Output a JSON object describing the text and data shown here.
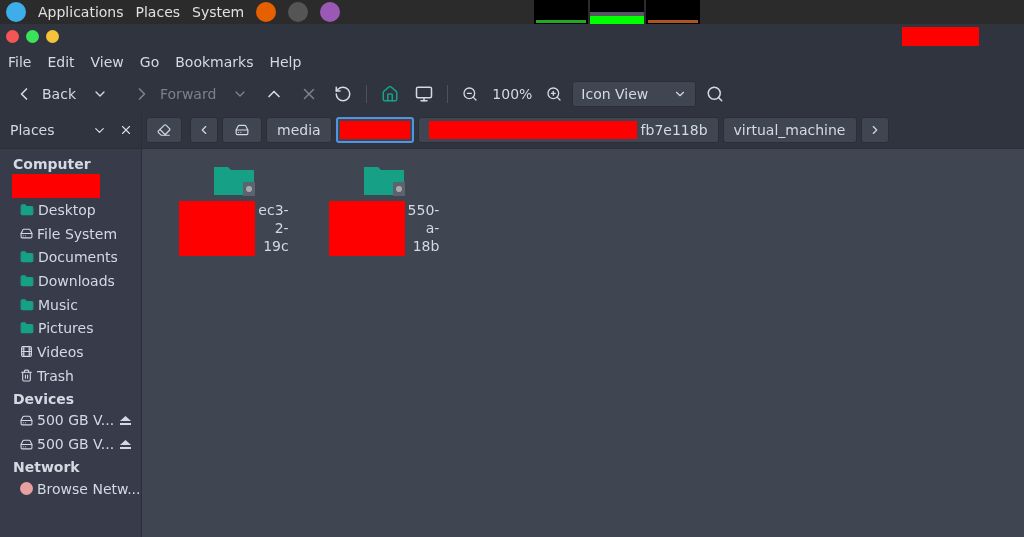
{
  "top_panel": {
    "menus": [
      "Applications",
      "Places",
      "System"
    ]
  },
  "window": {
    "title": {
      "kind": "redacted"
    }
  },
  "menubar": [
    "File",
    "Edit",
    "View",
    "Go",
    "Bookmarks",
    "Help"
  ],
  "toolbar": {
    "back": "Back",
    "forward": "Forward",
    "forward_disabled": true,
    "zoom": "100%",
    "view": "Icon View"
  },
  "sidebar": {
    "title": "Places",
    "sections": [
      {
        "title": "Computer",
        "items": [
          {
            "kind": "redacted"
          },
          {
            "label": "Desktop",
            "kind": "place"
          },
          {
            "label": "File System",
            "kind": "place"
          },
          {
            "label": "Documents",
            "kind": "place"
          },
          {
            "label": "Downloads",
            "kind": "place"
          },
          {
            "label": "Music",
            "kind": "place"
          },
          {
            "label": "Pictures",
            "kind": "place"
          },
          {
            "label": "Videos",
            "kind": "place"
          },
          {
            "label": "Trash",
            "kind": "place"
          }
        ]
      },
      {
        "title": "Devices",
        "items": [
          {
            "label": "500 GB V...",
            "kind": "device"
          },
          {
            "label": "500 GB V...",
            "kind": "device"
          }
        ]
      },
      {
        "title": "Network",
        "items": [
          {
            "label": "Browse Netw...",
            "kind": "place"
          }
        ]
      }
    ]
  },
  "pathbar": [
    {
      "label": "media",
      "kind": "plain",
      "selected": false
    },
    {
      "kind": "redacted",
      "selected": true
    },
    {
      "label": "fb7e118b",
      "kind": "partly_redacted",
      "selected": false
    },
    {
      "label": "virtual_machine",
      "kind": "plain",
      "selected": false
    }
  ],
  "files": [
    {
      "lines": [
        "ec3-",
        "2-",
        "19c"
      ],
      "kind": "partly_redacted"
    },
    {
      "lines": [
        "550-",
        "a-",
        "18b"
      ],
      "kind": "partly_redacted"
    }
  ]
}
